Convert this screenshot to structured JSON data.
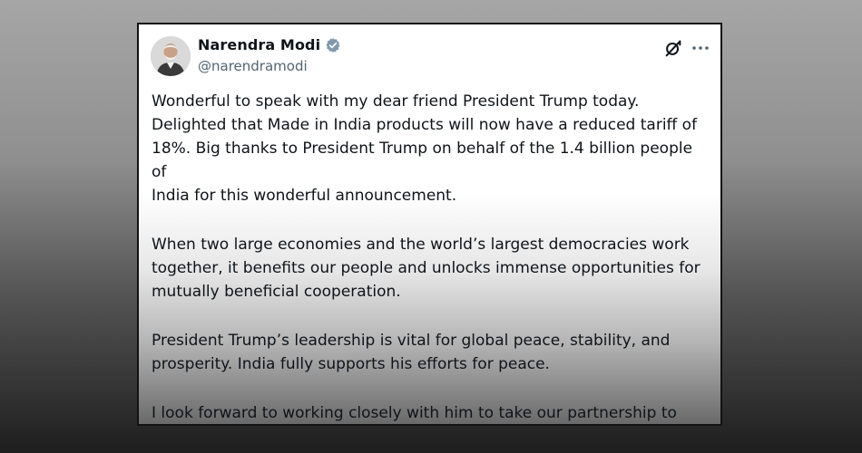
{
  "post": {
    "author_name": "Narendra Modi",
    "handle": "@narendramodi",
    "verified_icon": "verified-badge-icon",
    "grok_icon": "grok-icon",
    "more_icon": "more-horizontal-icon",
    "paragraphs": [
      "Wonderful to speak with my dear friend President Trump today.\nDelighted that Made in India products will now have a reduced tariff of\n18%. Big thanks to President Trump on behalf of the 1.4 billion people of\nIndia for this wonderful announcement.",
      "When two large economies and the world’s largest democracies work\ntogether, it benefits our people and unlocks immense opportunities for\nmutually beneficial cooperation.",
      "President Trump’s leadership is vital for global peace, stability, and\nprosperity. India fully supports his efforts for peace.",
      "I look forward to working closely with him to take our partnership to\nunprecedented heights."
    ]
  },
  "colors": {
    "text_primary": "#0f1419",
    "text_secondary": "#536471",
    "verified_badge": "#829aab",
    "card_border": "#121212"
  }
}
